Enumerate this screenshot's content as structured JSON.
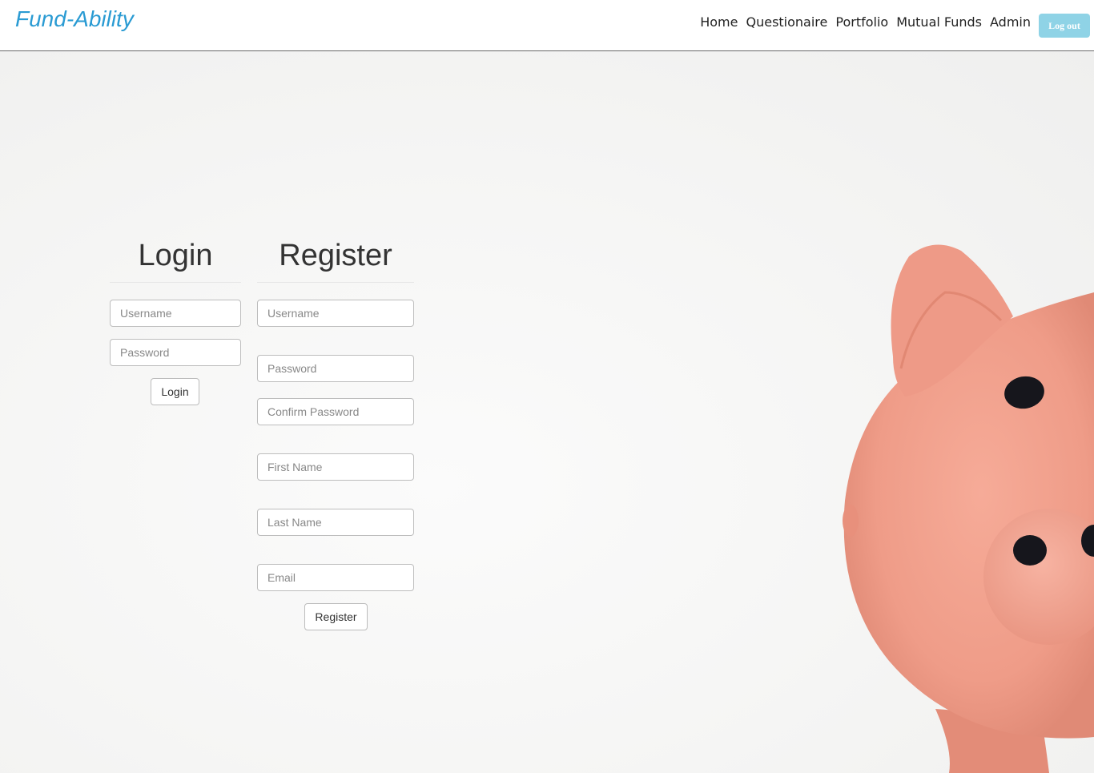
{
  "brand": "Fund-Ability",
  "nav": {
    "items": [
      "Home",
      "Questionaire",
      "Portfolio",
      "Mutual Funds",
      "Admin"
    ],
    "logout_label": "Log out"
  },
  "colors": {
    "brand": "#2a9bd3",
    "logout_bg": "#8fd3e6",
    "pig": "#f0a18e"
  },
  "login": {
    "title": "Login",
    "username_placeholder": "Username",
    "password_placeholder": "Password",
    "button": "Login"
  },
  "register": {
    "title": "Register",
    "username_placeholder": "Username",
    "password_placeholder": "Password",
    "confirm_placeholder": "Confirm Password",
    "first_name_placeholder": "First Name",
    "last_name_placeholder": "Last Name",
    "email_placeholder": "Email",
    "button": "Register"
  },
  "background_image": "piggy-bank"
}
